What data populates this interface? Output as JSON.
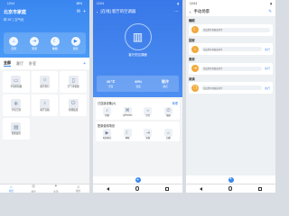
{
  "phone1": {
    "status_time": "12:04",
    "status_right": "88%",
    "home_title": "北京市家庭",
    "weather": "晴 26° | 空气优",
    "scenes": [
      {
        "label": "回家",
        "icon": "home-icon"
      },
      {
        "label": "离家",
        "icon": "leave-icon"
      },
      {
        "label": "睡眠",
        "icon": "sleep-icon"
      },
      {
        "label": "观影",
        "icon": "movie-icon"
      }
    ],
    "tabs": [
      "全部",
      "客厅",
      "卧室"
    ],
    "devices": [
      {
        "name": "手机控制器",
        "icon": "controller-icon"
      },
      {
        "name": "客厅吊灯",
        "icon": "lamp-icon"
      },
      {
        "name": "空气净化器",
        "icon": "purifier-icon"
      },
      {
        "name": "手机空调",
        "icon": "ac-icon"
      },
      {
        "name": "客厅音箱",
        "icon": "speaker-icon"
      },
      {
        "name": "智能插座",
        "icon": "plug-icon"
      },
      {
        "name": "智能窗帘",
        "icon": "curtain-icon"
      }
    ],
    "nav": [
      {
        "label": "家居",
        "icon": "home-nav-icon"
      },
      {
        "label": "场景",
        "icon": "scene-nav-icon"
      },
      {
        "label": "发现",
        "icon": "discover-nav-icon"
      },
      {
        "label": "我的",
        "icon": "me-nav-icon"
      }
    ]
  },
  "phone2": {
    "status_time": "12:04",
    "title": "[在线] 客厅的空调器",
    "device_label": "客厅的空调器",
    "stats": [
      {
        "label": "室温",
        "value": "26℃"
      },
      {
        "label": "湿度",
        "value": "45%"
      },
      {
        "label": "模式",
        "value": "制冷"
      }
    ],
    "section1_title": "已连接设备(4)",
    "section1_link": "管理",
    "section1_items": [
      "音箱",
      "QPT-KFD",
      "吊灯",
      "插座"
    ],
    "section2_title": "配置使用场景",
    "section2_items": [
      "电影模式",
      "睡眠",
      "离家",
      "回家"
    ]
  },
  "phone3": {
    "status_time": "12:04",
    "title": "手动场景",
    "edit_label": "✎",
    "scenes": [
      {
        "label": "睡眠",
        "pill": "请设置场景触发条件",
        "color": "#f2a93b"
      },
      {
        "label": "回家",
        "pill": "请设置场景触发条件",
        "color": "#f2a93b",
        "action": "执行"
      },
      {
        "label": "离家",
        "pill": "请设置场景触发条件",
        "color": "#f2a93b",
        "action": "执行"
      },
      {
        "label": "阅读",
        "pill": "请设置场景触发条件",
        "color": "#f2a93b",
        "action": "执行"
      }
    ]
  }
}
